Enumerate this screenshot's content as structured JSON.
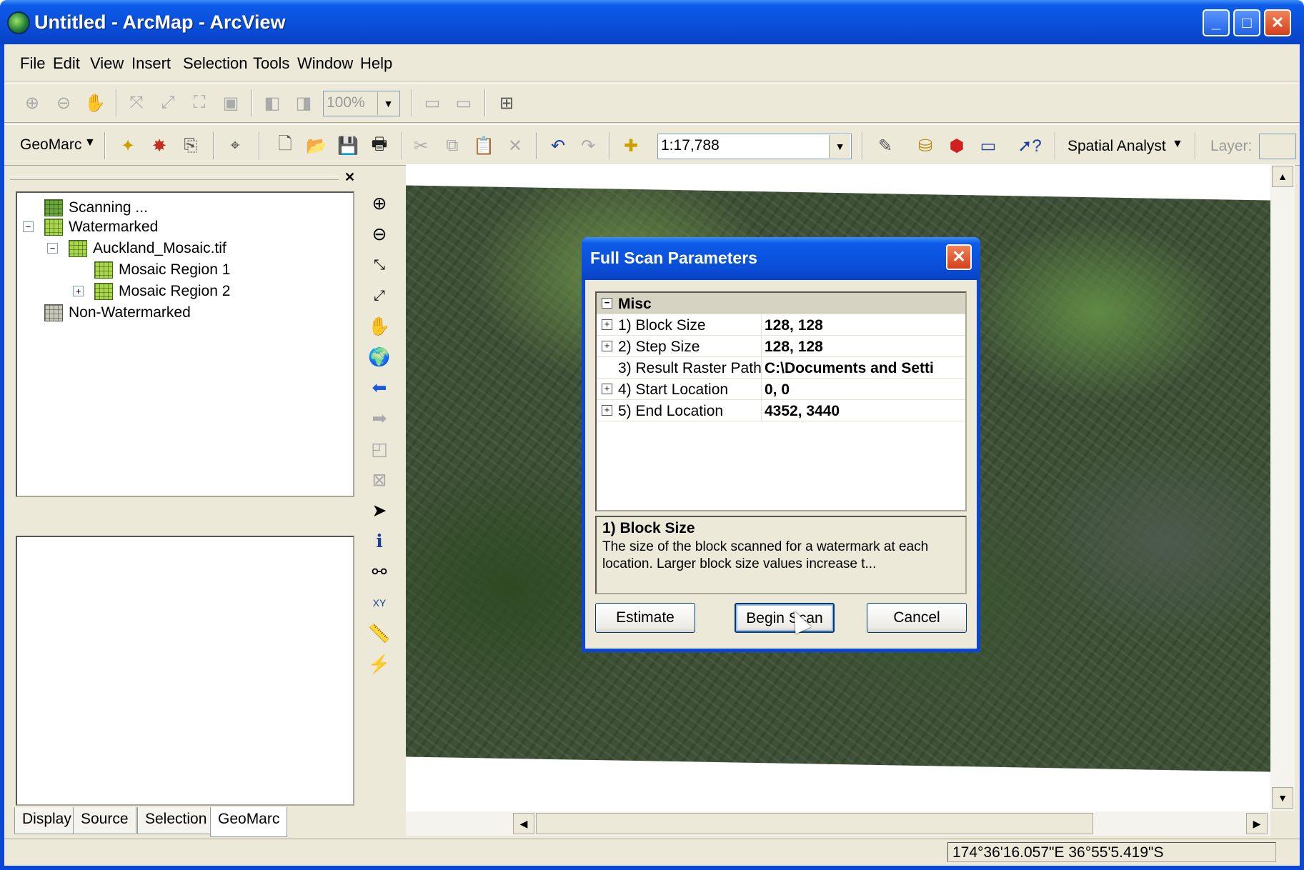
{
  "window": {
    "title": "Untitled - ArcMap - ArcView",
    "minimize": "_",
    "maximize": "□",
    "close": "✕"
  },
  "menu": [
    "File",
    "Edit",
    "View",
    "Insert",
    "Selection",
    "Tools",
    "Window",
    "Help"
  ],
  "toolbar1": {
    "zoom_value": "100%"
  },
  "toolbar2": {
    "geomarc_label": "GeoMarc",
    "scale_value": "1:17,788",
    "spatial_analyst_label": "Spatial Analyst",
    "layer_label": "Layer:"
  },
  "toc": {
    "items": [
      {
        "label": "Scanning ..."
      },
      {
        "label": "Watermarked"
      },
      {
        "label": "Auckland_Mosaic.tif"
      },
      {
        "label": "Mosaic Region 1"
      },
      {
        "label": "Mosaic Region 2"
      },
      {
        "label": "Non-Watermarked"
      }
    ],
    "tabs": [
      "Display",
      "Source",
      "Selection",
      "GeoMarc"
    ],
    "active_tab": "GeoMarc"
  },
  "dialog": {
    "title": "Full Scan Parameters",
    "category": "Misc",
    "properties": [
      {
        "name": "1) Block Size",
        "value": "128, 128"
      },
      {
        "name": "2) Step Size",
        "value": "128, 128"
      },
      {
        "name": "3) Result Raster Path",
        "value": "C:\\Documents and Setti"
      },
      {
        "name": "4) Start Location",
        "value": "0, 0"
      },
      {
        "name": "5) End Location",
        "value": "4352, 3440"
      }
    ],
    "description_title": "1) Block Size",
    "description_text": "The size of the block scanned for a watermark at each location.   Larger block size values increase t...",
    "buttons": {
      "estimate": "Estimate",
      "begin_scan": "Begin Scan",
      "cancel": "Cancel"
    }
  },
  "status": {
    "coordinates": "174°36'16.057\"E  36°55'5.419\"S"
  },
  "colors": {
    "titlebar": "#0a4ed8",
    "chrome": "#ece9d8",
    "close": "#d4401a"
  }
}
